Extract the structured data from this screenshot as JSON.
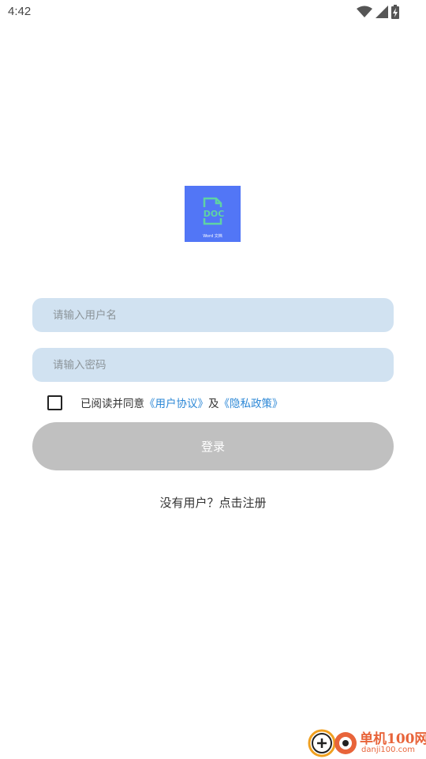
{
  "status_bar": {
    "time": "4:42"
  },
  "icons": {
    "wifi": "wifi-icon",
    "signal": "cellular-signal-icon",
    "battery": "battery-charging-icon",
    "logo_doc": "doc-file-icon"
  },
  "logo": {
    "badge_text": "DOC",
    "caption": "Word 文档"
  },
  "form": {
    "username_placeholder": "请输入用户名",
    "password_placeholder": "请输入密码",
    "agreement": {
      "prefix": "已阅读并同意",
      "user_agreement": "《用户协议》",
      "and": "及",
      "privacy_policy": "《隐私政策》",
      "checked": false
    },
    "login_label": "登录",
    "register_label": "没有用户？点击注册"
  },
  "watermark": {
    "name": "单机100网",
    "domain": "danji100.com"
  },
  "colors": {
    "input_bg": "#d1e2f1",
    "button_disabled": "#c0c0c0",
    "link": "#2b87d6",
    "logo_bg": "#5276f6",
    "logo_accent": "#5fd3a3",
    "watermark": "#e8643a"
  }
}
